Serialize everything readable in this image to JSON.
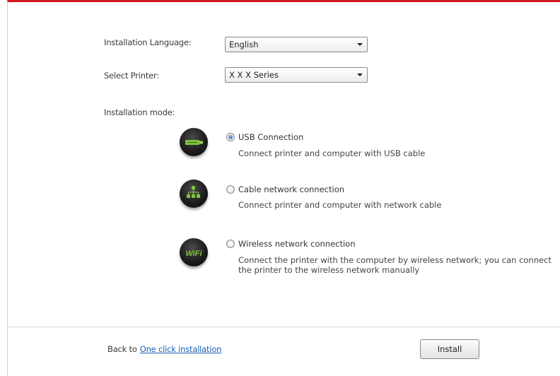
{
  "settings": {
    "language_label": "Installation Language:",
    "language_value": "English",
    "printer_label": "Select Printer:",
    "printer_value": "X X X  Series",
    "mode_label": "Installation mode:"
  },
  "modes": [
    {
      "icon": "usb-icon",
      "title": "USB Connection",
      "description": "Connect printer and computer with USB cable",
      "selected": true
    },
    {
      "icon": "network-cable-icon",
      "title": "Cable network connection",
      "description": "Connect printer and computer with network cable",
      "selected": false
    },
    {
      "icon": "wifi-icon",
      "icon_text": "WiFi",
      "title": "Wireless network connection",
      "description_line1": "Connect the printer with the computer by wireless network; you can connect",
      "description_line2": "the printer to the wireless network manually",
      "selected": false
    }
  ],
  "footer": {
    "back_text": "Back to",
    "back_link": "One click installation",
    "install_label": "Install"
  },
  "colors": {
    "accent_bar": "#d71920",
    "link": "#1a5fb4",
    "icon_green": "#7fc241"
  }
}
